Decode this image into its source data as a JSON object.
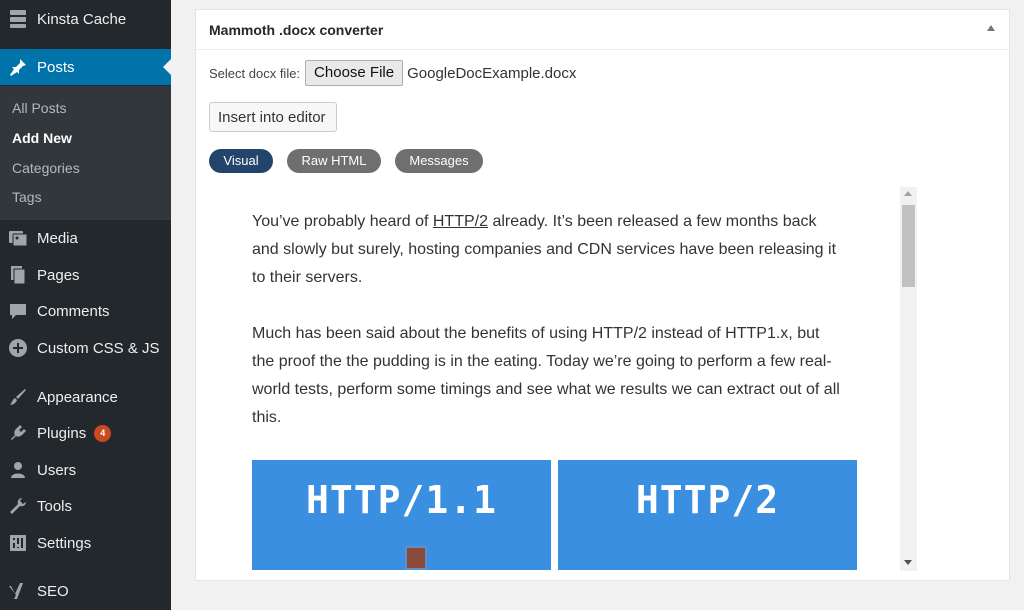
{
  "sidebar": {
    "kinsta_cache": "Kinsta Cache",
    "posts": "Posts",
    "submenu": [
      "All Posts",
      "Add New",
      "Categories",
      "Tags"
    ],
    "media": "Media",
    "pages": "Pages",
    "comments": "Comments",
    "custom_css": "Custom CSS & JS",
    "appearance": "Appearance",
    "plugins": "Plugins",
    "plugins_badge": "4",
    "users": "Users",
    "tools": "Tools",
    "settings": "Settings",
    "seo": "SEO"
  },
  "panel": {
    "title": "Mammoth .docx converter",
    "file_label": "Select docx file:",
    "choose_file": "Choose File",
    "file_name": "GoogleDocExample.docx",
    "insert_button": "Insert into editor",
    "tabs": [
      "Visual",
      "Raw HTML",
      "Messages"
    ]
  },
  "editor": {
    "p1_before": "You’ve probably heard of ",
    "p1_link": "HTTP/2",
    "p1_after": " already. It’s been released a few months back and slowly but surely, hosting companies and CDN services have been releasing it to their servers.",
    "p2": "Much has been said about the benefits of using HTTP/2 instead of HTTP1.x, but the proof the the pudding is in the eating. Today we’re going to perform a few real-world tests, perform some timings and see what we results we can extract out of all this.",
    "image_left": "HTTP/1.1",
    "image_right": "HTTP/2"
  },
  "colors": {
    "sidebar_bg": "#23282d",
    "active_bg": "#0073aa",
    "visual_tab": "#23446b",
    "image_blue": "#3b8fe0"
  }
}
